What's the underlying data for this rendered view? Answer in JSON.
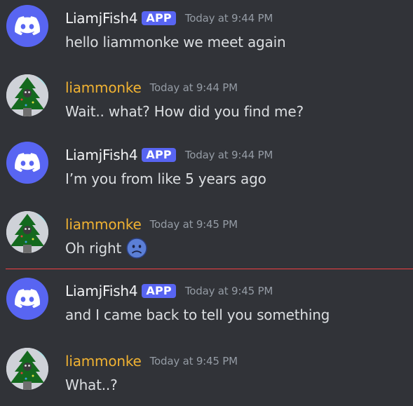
{
  "messages": [
    {
      "author": "LiamjFish4",
      "badge": "APP",
      "timestamp": "Today at 9:44 PM",
      "text": "hello liammonke we meet again",
      "kind": "bot"
    },
    {
      "author": "liammonke",
      "timestamp": "Today at 9:44 PM",
      "text": "Wait.. what? How did you find me?",
      "kind": "user"
    },
    {
      "author": "LiamjFish4",
      "badge": "APP",
      "timestamp": "Today at 9:44 PM",
      "text": "I’m you from like 5 years ago",
      "kind": "bot"
    },
    {
      "author": "liammonke",
      "timestamp": "Today at 9:45 PM",
      "text": "Oh right",
      "kind": "user",
      "emoji": "frowning-face-emoji"
    },
    {
      "author": "LiamjFish4",
      "badge": "APP",
      "timestamp": "Today at 9:45 PM",
      "text": "and I came back to tell you something",
      "kind": "bot"
    },
    {
      "author": "liammonke",
      "timestamp": "Today at 9:45 PM",
      "text": "What..?",
      "kind": "user"
    }
  ],
  "colors": {
    "background": "#313338",
    "blurple": "#5865f2",
    "user_name": "#f0b232",
    "timestamp": "#949ba4",
    "text": "#dbdee1",
    "new_divider": "#f23f43"
  },
  "icons": {
    "bot_avatar": "discord-logo-icon",
    "user_avatar": "monke-tree-avatar"
  }
}
